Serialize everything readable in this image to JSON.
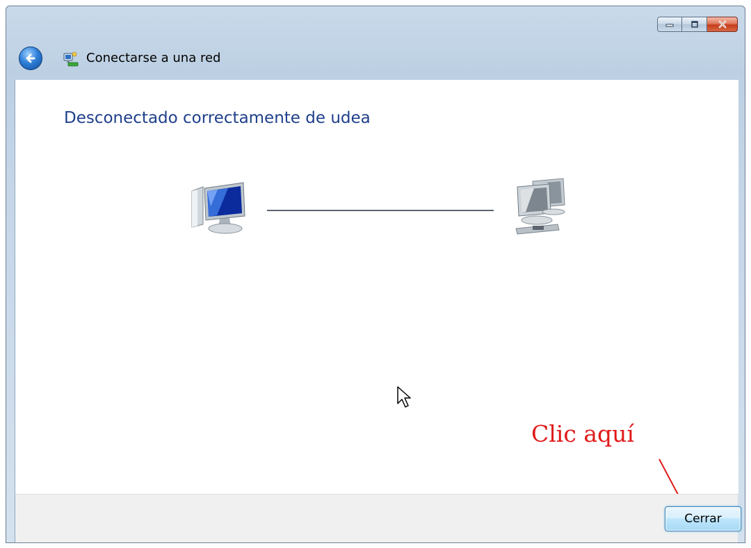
{
  "window": {
    "title": "Conectarse a una red",
    "controls": {
      "minimize_icon": "minimize-icon",
      "maximize_icon": "maximize-icon",
      "close_icon": "close-icon"
    }
  },
  "main": {
    "heading": "Desconectado correctamente de udea",
    "diagram": {
      "left_icon": "computer-icon",
      "right_icon": "network-icon",
      "connection": "connection-line"
    }
  },
  "annotation": {
    "text": "Clic aquí",
    "color": "#e01a1a"
  },
  "footer": {
    "close_button_label": "Cerrar"
  },
  "colors": {
    "heading": "#1e3f8a",
    "footer_bg": "#f0f0f0",
    "accent_button": "#3c7fb1"
  }
}
